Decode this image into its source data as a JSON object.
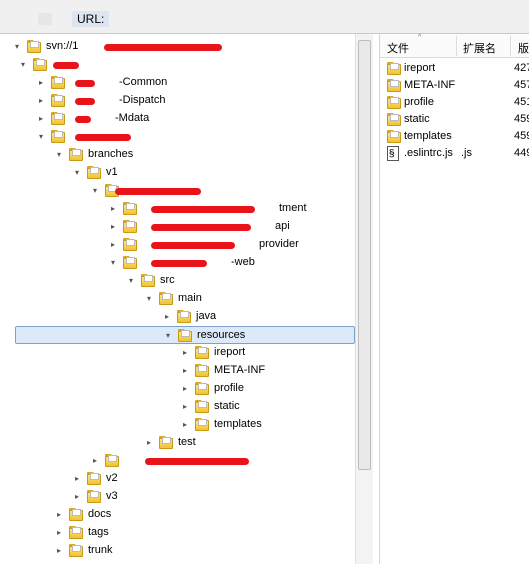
{
  "toolbar": {
    "url_label": "URL:"
  },
  "tree": {
    "rows": [
      {
        "label": "svn://1",
        "arrow": "▾",
        "state": "expanded"
      },
      {
        "label": "",
        "arrow": "▾",
        "state": "expanded"
      },
      {
        "label": "-Common",
        "arrow": "▸",
        "state": "collapsed"
      },
      {
        "label": "-Dispatch",
        "arrow": "▸",
        "state": "collapsed"
      },
      {
        "label": "-Mdata",
        "arrow": "▸",
        "state": "collapsed"
      },
      {
        "label": "",
        "arrow": "▾",
        "state": "expanded"
      },
      {
        "label": "branches",
        "arrow": "▾",
        "state": "expanded"
      },
      {
        "label": "v1",
        "arrow": "▾",
        "state": "expanded"
      },
      {
        "label": "",
        "arrow": "▾",
        "state": "expanded"
      },
      {
        "label": "tment",
        "arrow": "▸",
        "state": "collapsed"
      },
      {
        "label": "api",
        "arrow": "▸",
        "state": "collapsed"
      },
      {
        "label": "provider",
        "arrow": "▸",
        "state": "collapsed"
      },
      {
        "label": "-web",
        "arrow": "▾",
        "state": "expanded"
      },
      {
        "label": "src",
        "arrow": "▾",
        "state": "expanded"
      },
      {
        "label": "main",
        "arrow": "▾",
        "state": "expanded"
      },
      {
        "label": "java",
        "arrow": "▸",
        "state": "collapsed"
      },
      {
        "label": "resources",
        "arrow": "▾",
        "state": "selected"
      },
      {
        "label": "ireport",
        "arrow": "▸",
        "state": "collapsed"
      },
      {
        "label": "META-INF",
        "arrow": "▸",
        "state": "collapsed"
      },
      {
        "label": "profile",
        "arrow": "▸",
        "state": "collapsed"
      },
      {
        "label": "static",
        "arrow": "▸",
        "state": "collapsed"
      },
      {
        "label": "templates",
        "arrow": "▸",
        "state": "collapsed"
      },
      {
        "label": "test",
        "arrow": "▸",
        "state": "collapsed"
      },
      {
        "label": "",
        "arrow": "▸",
        "state": "collapsed"
      },
      {
        "label": "v2",
        "arrow": "▸",
        "state": "collapsed"
      },
      {
        "label": "v3",
        "arrow": "▸",
        "state": "collapsed"
      },
      {
        "label": "docs",
        "arrow": "▸",
        "state": "collapsed"
      },
      {
        "label": "tags",
        "arrow": "▸",
        "state": "collapsed"
      },
      {
        "label": "trunk",
        "arrow": "▸",
        "state": "collapsed"
      }
    ]
  },
  "file_list": {
    "columns": {
      "name": "文件",
      "ext": "扩展名",
      "size": "版"
    },
    "rows": [
      {
        "name": "ireport",
        "ext": "",
        "size": "427",
        "icon": "folder-icon"
      },
      {
        "name": "META-INF",
        "ext": "",
        "size": "457",
        "icon": "folder-icon"
      },
      {
        "name": "profile",
        "ext": "",
        "size": "451",
        "icon": "folder-icon"
      },
      {
        "name": "static",
        "ext": "",
        "size": "459",
        "icon": "folder-icon"
      },
      {
        "name": "templates",
        "ext": "",
        "size": "459",
        "icon": "folder-icon"
      },
      {
        "name": ".eslintrc.js",
        "ext": ".js",
        "size": "449",
        "icon": "js-file-icon"
      }
    ]
  },
  "colors": {
    "selection_bg": "#dce9f8",
    "selection_border": "#7da2ce",
    "redaction": "#e8141a",
    "folder": "#f1c232"
  }
}
